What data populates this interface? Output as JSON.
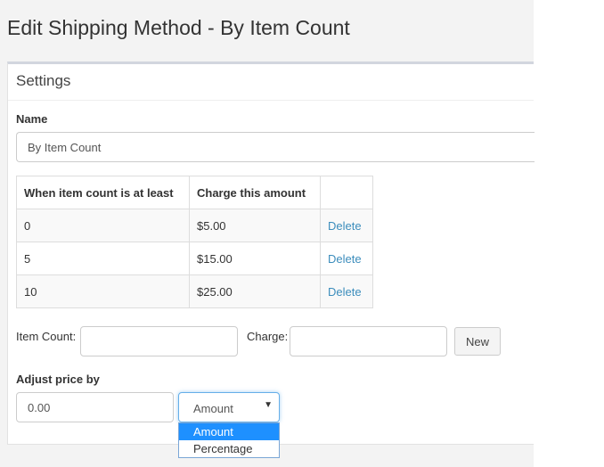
{
  "page": {
    "title": "Edit Shipping Method - By Item Count"
  },
  "panel": {
    "title": "Settings"
  },
  "name_field": {
    "label": "Name",
    "value": "By Item Count"
  },
  "tiers_table": {
    "headers": [
      "When item count is at least",
      "Charge this amount",
      ""
    ],
    "rows": [
      {
        "min_count": "0",
        "charge": "$5.00",
        "action": "Delete"
      },
      {
        "min_count": "5",
        "charge": "$15.00",
        "action": "Delete"
      },
      {
        "min_count": "10",
        "charge": "$25.00",
        "action": "Delete"
      }
    ]
  },
  "new_tier": {
    "item_count_label": "Item Count:",
    "item_count_value": "",
    "charge_label": "Charge:",
    "charge_value": "",
    "new_button": "New"
  },
  "adjust": {
    "label": "Adjust price by",
    "value": "0.00",
    "selected": "Amount",
    "options": [
      "Amount",
      "Percentage"
    ]
  },
  "colors": {
    "link": "#3c8dbc",
    "selected_option": "#1e90ff",
    "focus_border": "#66afe9",
    "page_bg": "#f3f3f3"
  }
}
